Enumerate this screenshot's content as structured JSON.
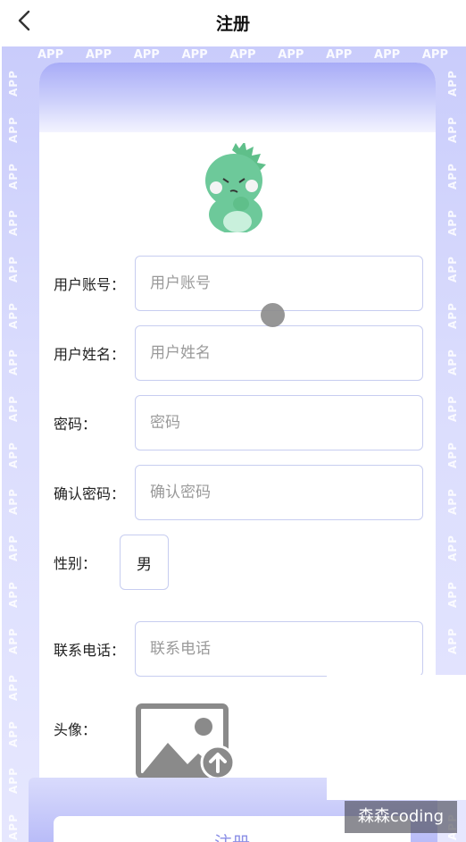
{
  "header": {
    "title": "注册"
  },
  "banner": {
    "text": "APP"
  },
  "form": {
    "account": {
      "label": "用户账号：",
      "placeholder": "用户账号"
    },
    "name": {
      "label": "用户姓名：",
      "placeholder": "用户姓名"
    },
    "password": {
      "label": "密码：",
      "placeholder": "密码"
    },
    "confirm": {
      "label": "确认密码：",
      "placeholder": "确认密码"
    },
    "gender": {
      "label": "性别：",
      "value": "男"
    },
    "phone": {
      "label": "联系电话：",
      "placeholder": "联系电话"
    },
    "avatar": {
      "label": "头像："
    }
  },
  "submit_label": "注册",
  "watermark": "森森coding",
  "colors": {
    "accent": "#a8acf7",
    "border": "#c7cdf0",
    "mascot": "#6dc99a"
  },
  "icons": [
    "chevron-left-icon",
    "dinosaur-mascot",
    "image-upload-icon"
  ]
}
